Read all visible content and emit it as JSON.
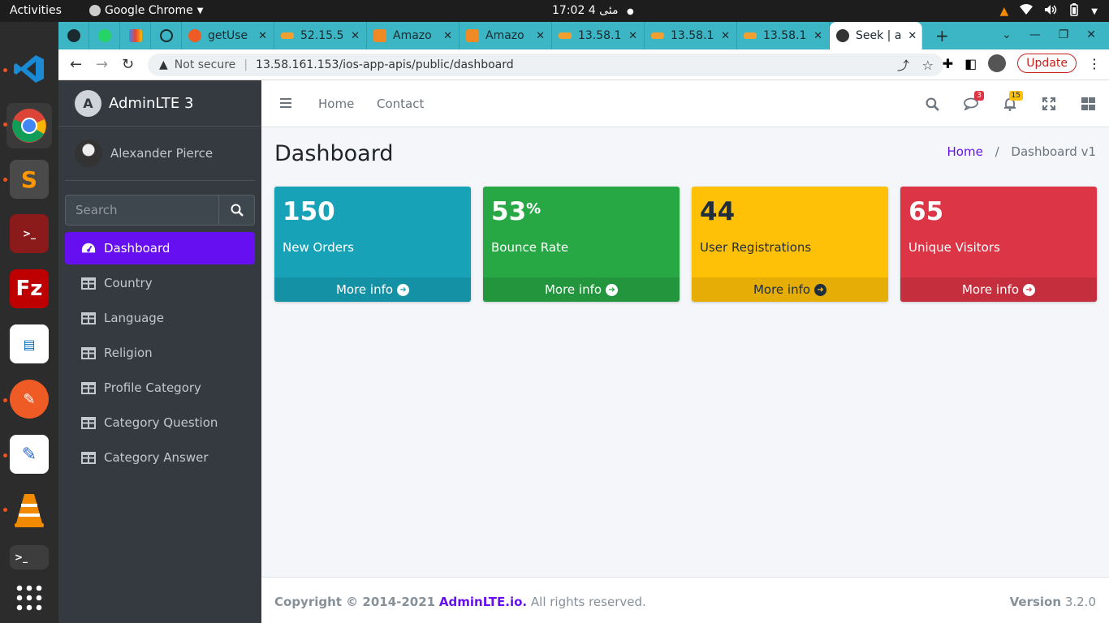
{
  "os": {
    "activities": "Activities",
    "app_name": "Google Chrome",
    "clock": "17:02  4 مئى",
    "dock_items": [
      "vscode",
      "chrome",
      "sublime-text",
      "terminal-app",
      "filezilla",
      "libreoffice-impress",
      "postman",
      "text-editor",
      "vlc",
      "terminal",
      "show-apps"
    ]
  },
  "browser": {
    "tabs": [
      {
        "title": "",
        "icon": "github-icon",
        "pinned": true
      },
      {
        "title": "",
        "icon": "whatsapp-icon",
        "pinned": true
      },
      {
        "title": "",
        "icon": "gmail-icon",
        "pinned": true
      },
      {
        "title": "",
        "icon": "chatgpt-icon",
        "pinned": true
      },
      {
        "title": "getUse",
        "icon": "postman-icon"
      },
      {
        "title": "52.15.5",
        "icon": "phpmyadmin-icon"
      },
      {
        "title": "Amazo",
        "icon": "aws-icon"
      },
      {
        "title": "Amazo",
        "icon": "aws-icon"
      },
      {
        "title": "13.58.1",
        "icon": "phpmyadmin-icon"
      },
      {
        "title": "13.58.1",
        "icon": "phpmyadmin-icon"
      },
      {
        "title": "13.58.1",
        "icon": "phpmyadmin-icon"
      },
      {
        "title": "Seek | a",
        "icon": "globe-icon",
        "active": true
      }
    ],
    "new_tab": "+",
    "not_secure": "Not secure",
    "url": "13.58.161.153/ios-app-apis/public/dashboard",
    "update_label": "Update"
  },
  "sidebar": {
    "brand": "AdminLTE 3",
    "user": "Alexander Pierce",
    "search_placeholder": "Search",
    "items": [
      {
        "label": "Dashboard",
        "icon": "dashboard-icon",
        "active": true
      },
      {
        "label": "Country",
        "icon": "table-icon"
      },
      {
        "label": "Language",
        "icon": "table-icon"
      },
      {
        "label": "Religion",
        "icon": "table-icon"
      },
      {
        "label": "Profile Category",
        "icon": "table-icon"
      },
      {
        "label": "Category Question",
        "icon": "table-icon"
      },
      {
        "label": "Category Answer",
        "icon": "table-icon"
      }
    ]
  },
  "header": {
    "nav": [
      "Home",
      "Contact"
    ],
    "messages_badge": "3",
    "notifications_badge": "15"
  },
  "page": {
    "title": "Dashboard",
    "breadcrumb_home": "Home",
    "breadcrumb_sep": "/",
    "breadcrumb_current": "Dashboard v1"
  },
  "boxes": [
    {
      "value": "150",
      "suffix": "",
      "label": "New Orders",
      "more": "More info",
      "color": "#17a2b8"
    },
    {
      "value": "53",
      "suffix": "%",
      "label": "Bounce Rate",
      "more": "More info",
      "color": "#28a745"
    },
    {
      "value": "44",
      "suffix": "",
      "label": "User Registrations",
      "more": "More info",
      "color": "#ffc107"
    },
    {
      "value": "65",
      "suffix": "",
      "label": "Unique Visitors",
      "more": "More info",
      "color": "#dc3545"
    }
  ],
  "footer": {
    "copyright": "Copyright © 2014-2021",
    "brand_link": "AdminLTE.io.",
    "rights": "All rights reserved.",
    "version_label": "Version",
    "version": "3.2.0"
  }
}
